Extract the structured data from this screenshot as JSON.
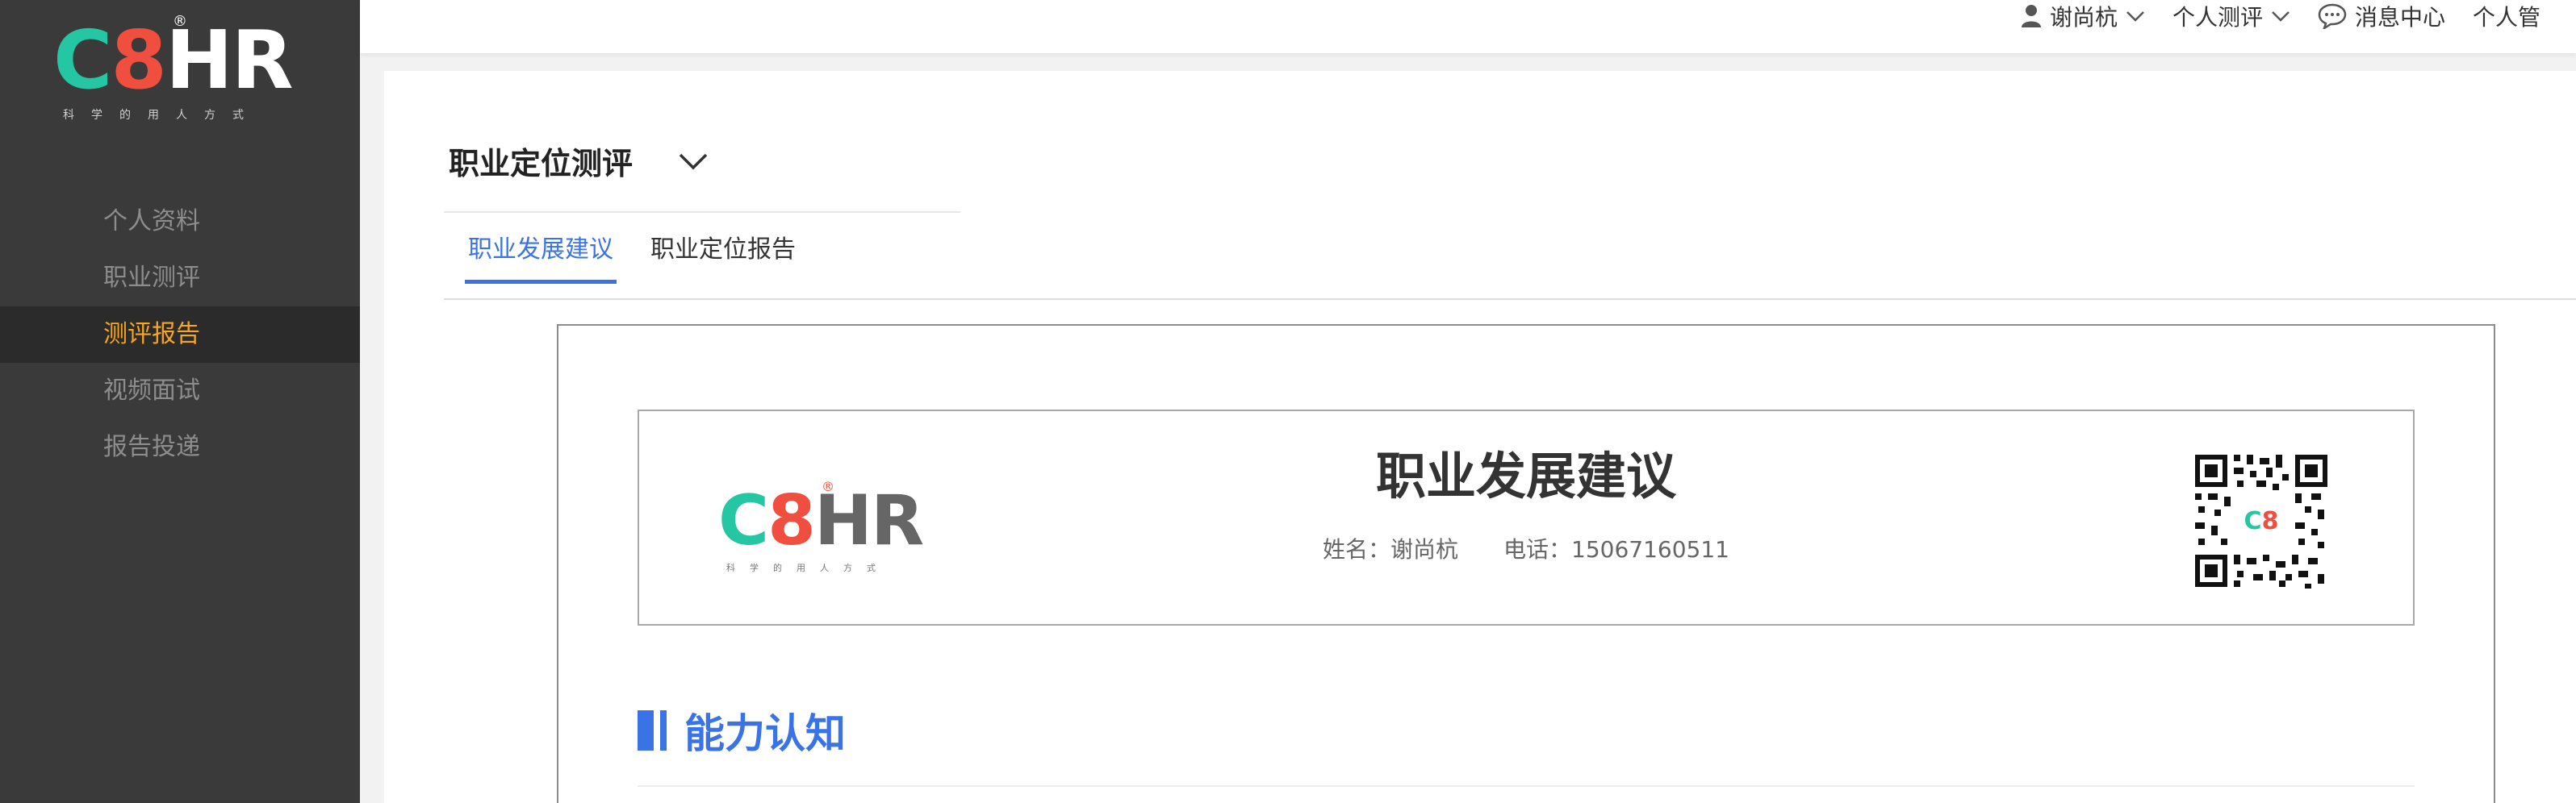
{
  "sidebar": {
    "logo": {
      "c": "C",
      "eight": "8",
      "hr": "HR",
      "reg": "®",
      "tagline": "科学的用人方式"
    },
    "items": [
      {
        "label": "个人资料"
      },
      {
        "label": "职业测评"
      },
      {
        "label": "测评报告"
      },
      {
        "label": "视频面试"
      },
      {
        "label": "报告投递"
      }
    ],
    "active_index": 2
  },
  "header": {
    "user_name": "谢尚杭",
    "assessment_menu": "个人测评",
    "messages": "消息中心",
    "manage": "个人管"
  },
  "main": {
    "title": "职业定位测评",
    "tabs": [
      {
        "label": "职业发展建议"
      },
      {
        "label": "职业定位报告"
      }
    ]
  },
  "report": {
    "logo": {
      "c": "C",
      "eight": "8",
      "hr": "HR",
      "reg": "®",
      "tagline": "科学的用人方式"
    },
    "title": "职业发展建议",
    "name_text": "姓名：谢尚杭",
    "phone_text": "电话：15067160511",
    "section_title": "能力认知"
  },
  "colors": {
    "sidebar_bg": "#3a3a3a",
    "active_menu": "#f6a623",
    "accent_blue": "#3a73e6",
    "logo_green": "#25c6a3",
    "logo_red": "#f04f3f"
  },
  "icons": [
    "user-icon",
    "chevron-down-icon",
    "chat-bubble-icon",
    "qr-code-icon"
  ]
}
